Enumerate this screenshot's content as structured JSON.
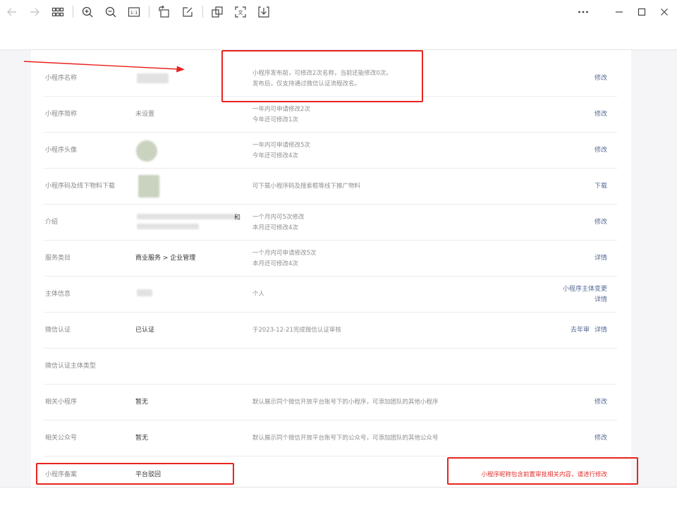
{
  "toolbar": {
    "icons": [
      "arrow-left-icon",
      "arrow-right-icon",
      "grid-icon",
      "zoom-in-icon",
      "zoom-out-icon",
      "actual-size-icon",
      "rotate-icon",
      "edit-icon",
      "copy-icon",
      "ocr-icon",
      "download-icon",
      "more-icon",
      "minimize-icon",
      "maximize-icon",
      "close-icon"
    ],
    "actual_size_label": "1:1",
    "ocr_label": "文"
  },
  "rows": [
    {
      "label": "小程序名称",
      "value": "",
      "desc": [
        "小程序发布前，可修改2次名称，当前还能修改0次。",
        "发布后，仅支持通过微信认证流程改名。"
      ],
      "actions": [
        "修改"
      ]
    },
    {
      "label": "小程序简称",
      "value": "未设置",
      "desc": [
        "一年内可申请修改2次",
        "今年还可修改1次"
      ],
      "actions": [
        "修改"
      ]
    },
    {
      "label": "小程序头像",
      "value": "",
      "desc": [
        "一年内可申请修改5次",
        "今年还可修改4次"
      ],
      "actions": [
        "修改"
      ]
    },
    {
      "label": "小程序码及线下物料下载",
      "value": "",
      "desc": [
        "可下载小程序码及搜索框等线下推广物料"
      ],
      "actions": [
        "下载"
      ]
    },
    {
      "label": "介绍",
      "value": "和",
      "desc": [
        "一个月内可5次修改",
        "本月还可修改4次"
      ],
      "actions": [
        "修改"
      ]
    },
    {
      "label": "服务类目",
      "value": "商业服务 > 企业管理",
      "desc": [
        "一个月内可申请修改5次",
        "本月还可修改4次"
      ],
      "actions": [
        "详情"
      ]
    },
    {
      "label": "主体信息",
      "value": "",
      "desc": [
        "个人"
      ],
      "actions": [
        "小程序主体变更",
        "详情"
      ]
    },
    {
      "label": "微信认证",
      "value": "已认证",
      "desc": [
        "于2023-12-21完成微信认证审核"
      ],
      "actions": [
        "去年审",
        "详情"
      ]
    },
    {
      "label": "微信认证主体类型",
      "value": "",
      "desc": [],
      "actions": []
    },
    {
      "label": "相关小程序",
      "value": "暂无",
      "desc": [
        "默认展示同个微信开放平台账号下的小程序，可添加团队的其他小程序"
      ],
      "actions": [
        "修改"
      ]
    },
    {
      "label": "相关公众号",
      "value": "暂无",
      "desc": [
        "默认展示同个微信开放平台账号下的公众号，可添加团队的其他公众号"
      ],
      "actions": [
        "修改"
      ]
    },
    {
      "label": "小程序备案",
      "value": "平台驳回",
      "desc": [],
      "actions": [
        "小程序昵称包含前置审批相关内容，请进行修改"
      ]
    }
  ],
  "colors": {
    "link": "#576b95",
    "annotation": "#e8241f",
    "error_text": "#e0312f"
  }
}
